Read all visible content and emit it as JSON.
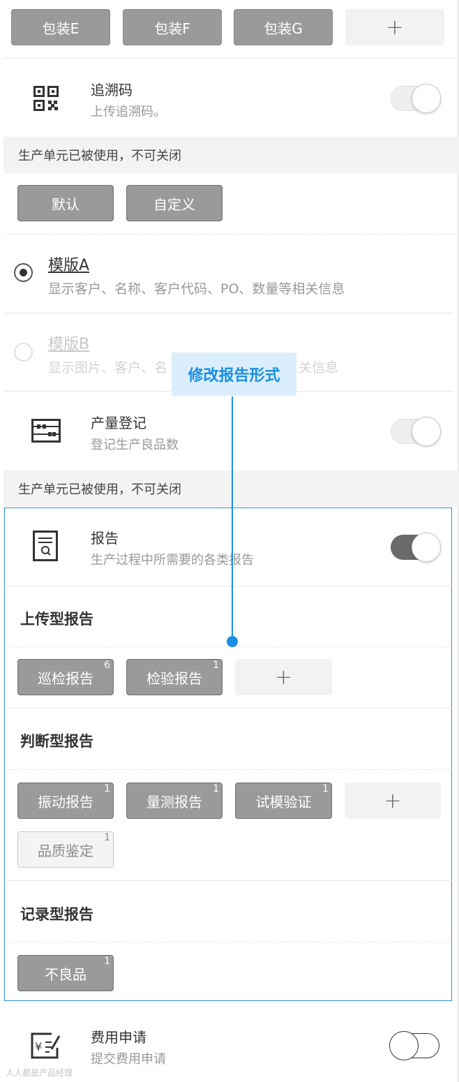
{
  "packaging": {
    "chips": [
      "包装E",
      "包装F",
      "包装G"
    ],
    "add": "+"
  },
  "trace": {
    "title": "追溯码",
    "subtitle": "上传追溯码。",
    "icon": "qr-code-icon",
    "toggle": "disabled-on"
  },
  "notice1": "生产单元已被使用，不可关闭",
  "templateMode": {
    "default_label": "默认",
    "custom_label": "自定义"
  },
  "templates": [
    {
      "name": "模版A",
      "desc": "显示客户、名称、客户代码、PO、数量等相关信息",
      "selected": true
    },
    {
      "name": "模版B",
      "desc": "显示图片、客户、名",
      "desc_tail": "关信息",
      "selected": false
    }
  ],
  "annotation": {
    "label": "修改报告形式",
    "color": "#1a8fe3",
    "bg": "#dbeefc"
  },
  "output": {
    "title": "产量登记",
    "subtitle": "登记生产良品数",
    "icon": "abacus-icon",
    "toggle": "disabled-on"
  },
  "notice2": "生产单元已被使用，不可关闭",
  "report": {
    "title": "报告",
    "subtitle": "生产过程中所需要的各类报告",
    "icon": "report-icon",
    "toggle": "on",
    "sections": {
      "upload": {
        "title": "上传型报告",
        "chips": [
          {
            "label": "巡检报告",
            "count": "6"
          },
          {
            "label": "检验报告",
            "count": "1"
          }
        ],
        "add": "+"
      },
      "judge": {
        "title": "判断型报告",
        "chips": [
          {
            "label": "振动报告",
            "count": "1"
          },
          {
            "label": "量测报告",
            "count": "1"
          },
          {
            "label": "试模验证",
            "count": "1"
          }
        ],
        "add": "+",
        "extra": {
          "label": "品质鉴定",
          "count": "1"
        }
      },
      "record": {
        "title": "记录型报告",
        "chips": [
          {
            "label": "不良品",
            "count": "1"
          }
        ]
      }
    }
  },
  "expense": {
    "title": "费用申请",
    "subtitle": "提交费用申请",
    "icon": "expense-icon",
    "toggle": "off"
  },
  "watermark": "人人都是产品经理"
}
